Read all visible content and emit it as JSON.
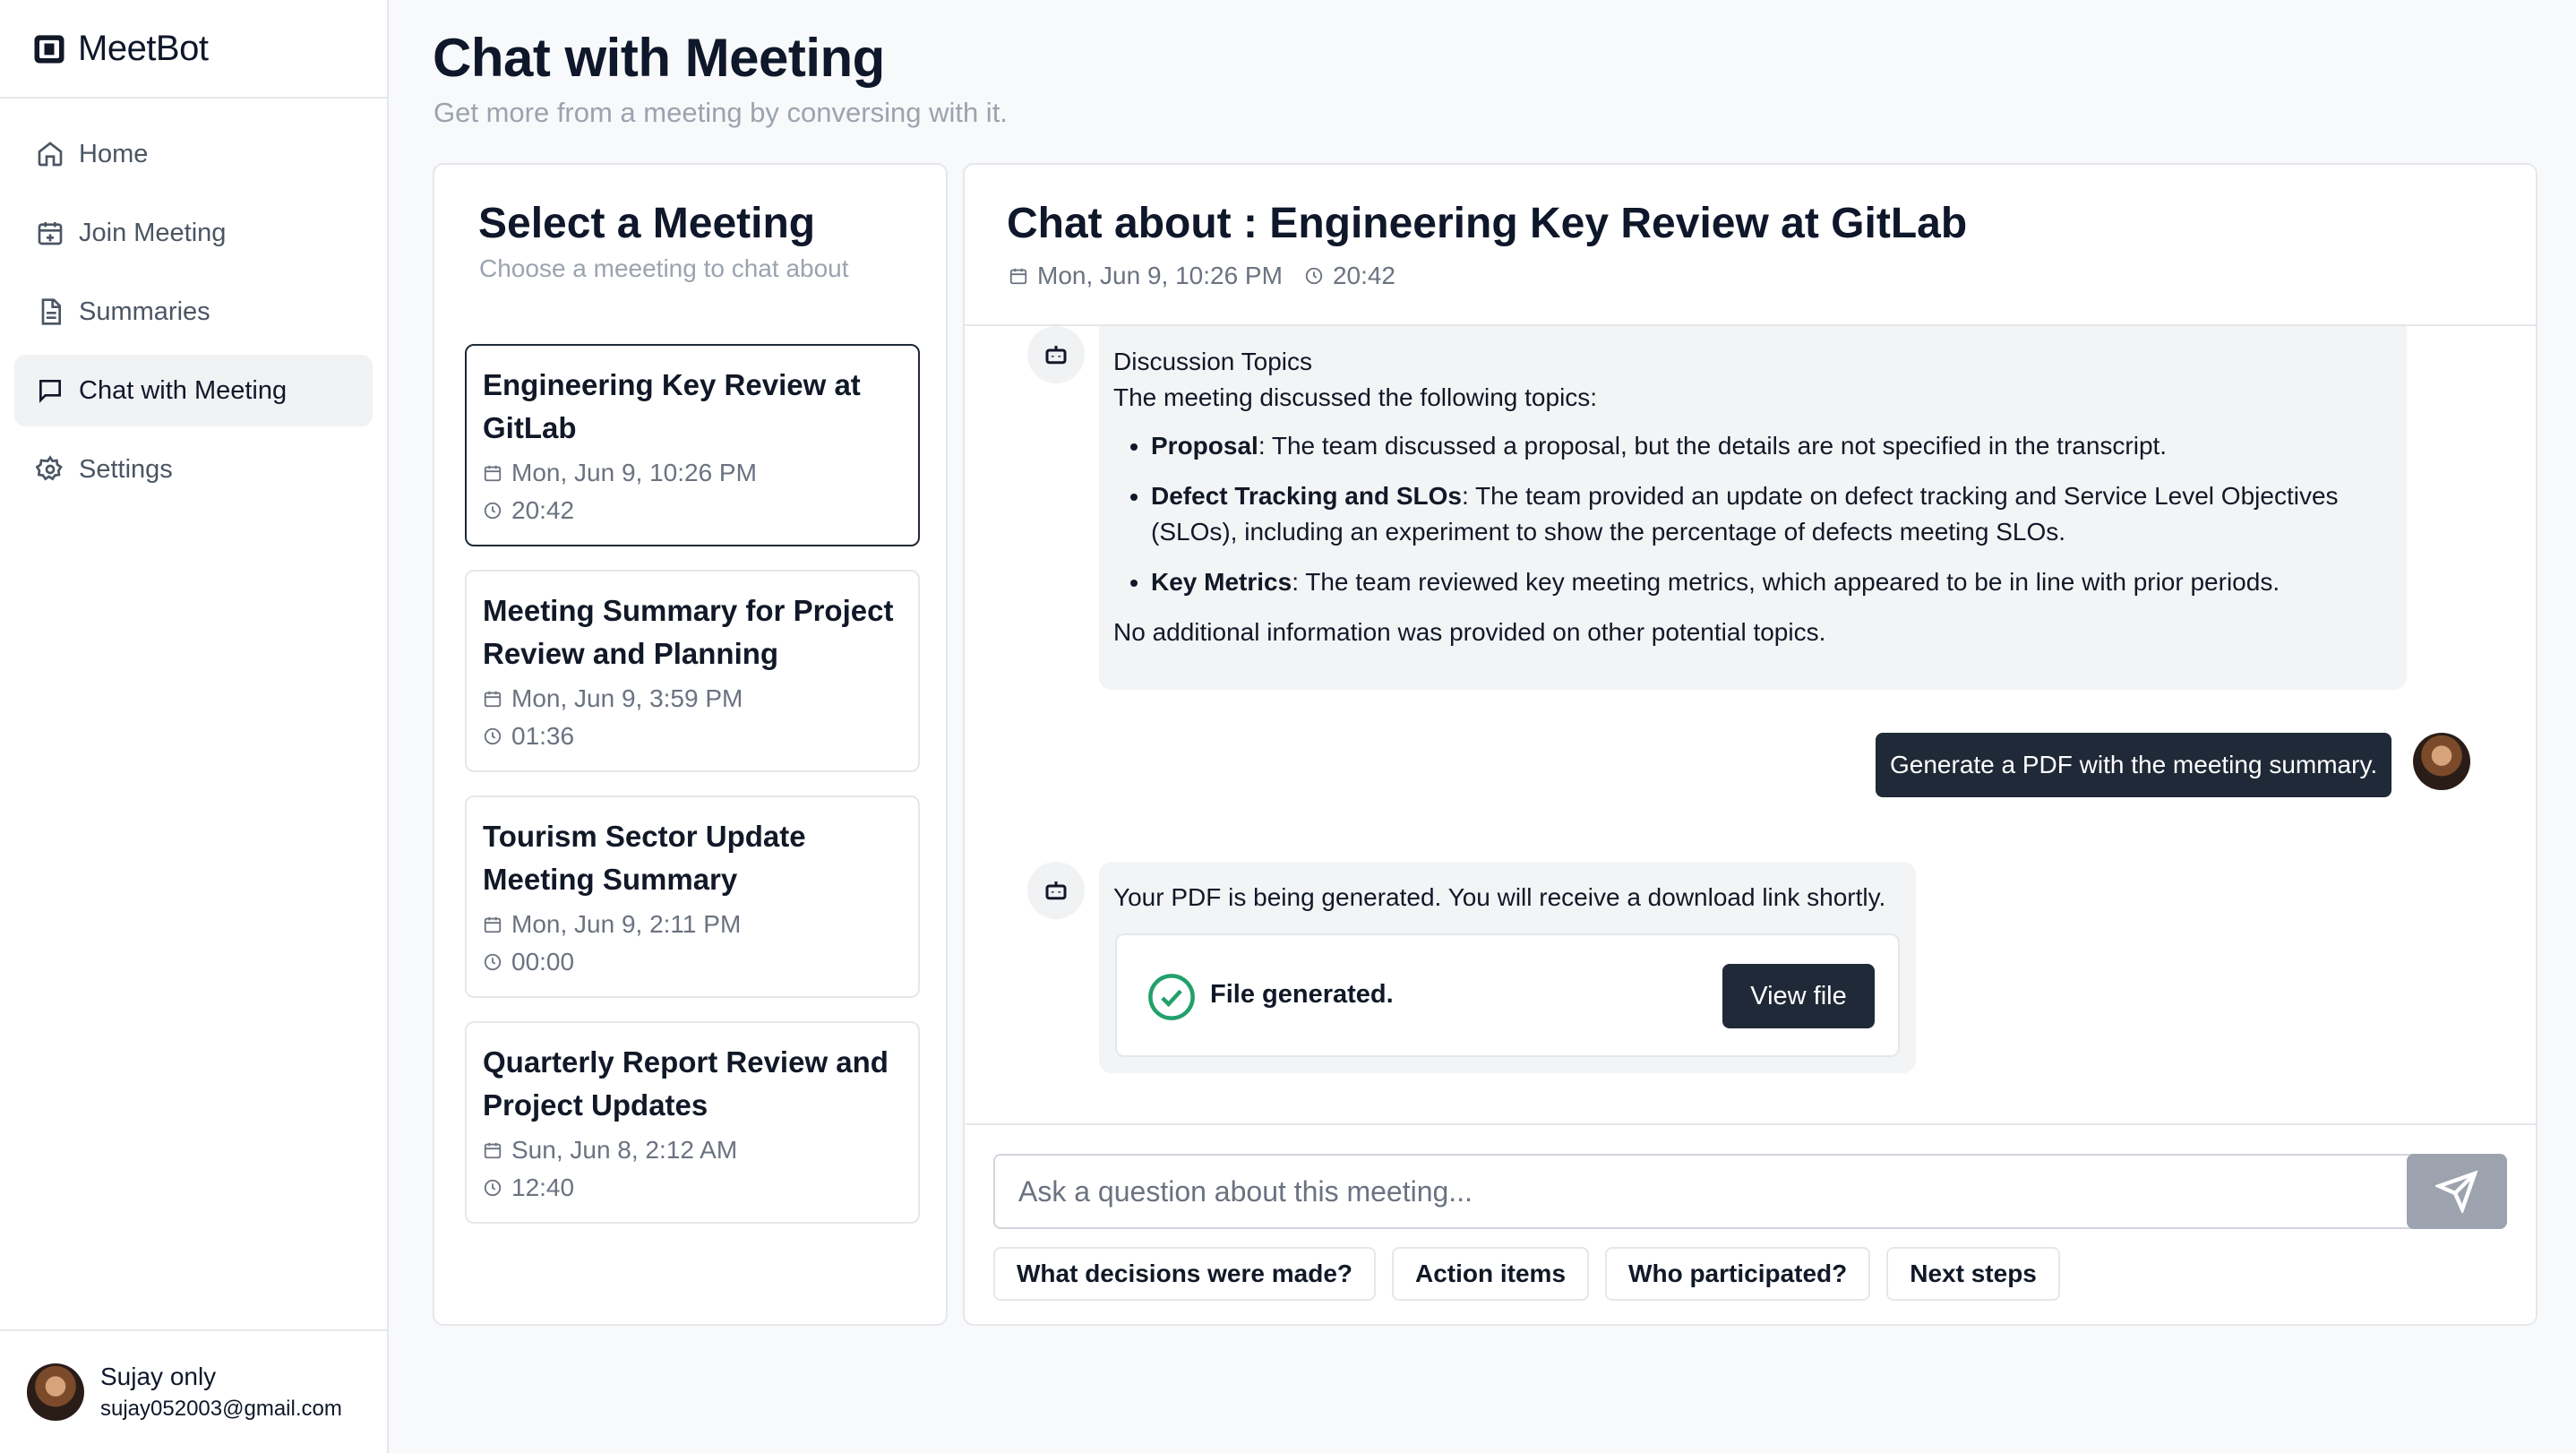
{
  "app": {
    "name": "MeetBot"
  },
  "sidebar": {
    "items": [
      {
        "label": "Home",
        "icon": "home-icon"
      },
      {
        "label": "Join Meeting",
        "icon": "calendar-plus-icon"
      },
      {
        "label": "Summaries",
        "icon": "document-icon"
      },
      {
        "label": "Chat with Meeting",
        "icon": "chat-icon",
        "active": true
      },
      {
        "label": "Settings",
        "icon": "gear-icon"
      }
    ]
  },
  "user": {
    "name": "Sujay only",
    "email": "sujay052003@gmail.com"
  },
  "header": {
    "title": "Chat with Meeting",
    "subtitle": "Get more from a meeting by conversing with it."
  },
  "meeting_list": {
    "title": "Select a Meeting",
    "subtitle": "Choose a meeeting to chat about",
    "items": [
      {
        "title": "Engineering Key Review at GitLab",
        "date": "Mon, Jun 9, 10:26 PM",
        "duration": "20:42",
        "selected": true
      },
      {
        "title": "Meeting Summary for Project Review and Planning",
        "date": "Mon, Jun 9, 3:59 PM",
        "duration": "01:36"
      },
      {
        "title": "Tourism Sector Update Meeting Summary",
        "date": "Mon, Jun 9, 2:11 PM",
        "duration": "00:00"
      },
      {
        "title": "Quarterly Report Review and Project Updates",
        "date": "Sun, Jun 8, 2:12 AM",
        "duration": "12:40"
      }
    ]
  },
  "chat": {
    "title": "Chat about : Engineering Key Review at GitLab",
    "date": "Mon, Jun 9, 10:26 PM",
    "duration": "20:42",
    "bot_message_1": {
      "heading": "Discussion Topics",
      "intro": "The meeting discussed the following topics:",
      "bullets": [
        {
          "term": "Proposal",
          "text": ": The team discussed a proposal, but the details are not specified in the transcript."
        },
        {
          "term": "Defect Tracking and SLOs",
          "text": ": The team provided an update on defect tracking and Service Level Objectives (SLOs), including an experiment to show the percentage of defects meeting SLOs."
        },
        {
          "term": "Key Metrics",
          "text": ": The team reviewed key meeting metrics, which appeared to be in line with prior periods."
        }
      ],
      "outro": "No additional information was provided on other potential topics."
    },
    "user_message": "Generate a PDF with the meeting summary.",
    "bot_message_2": {
      "text": "Your PDF is being generated. You will receive a download link shortly.",
      "file_status": "File generated.",
      "view_button": "View file"
    },
    "input_placeholder": "Ask a question about this meeting...",
    "suggestions": [
      "What decisions were made?",
      "Action items",
      "Who participated?",
      "Next steps"
    ]
  },
  "colors": {
    "primary": "#1f2937",
    "success": "#22a06b",
    "muted": "#9ca3af",
    "bubble": "#f3f4f6"
  }
}
